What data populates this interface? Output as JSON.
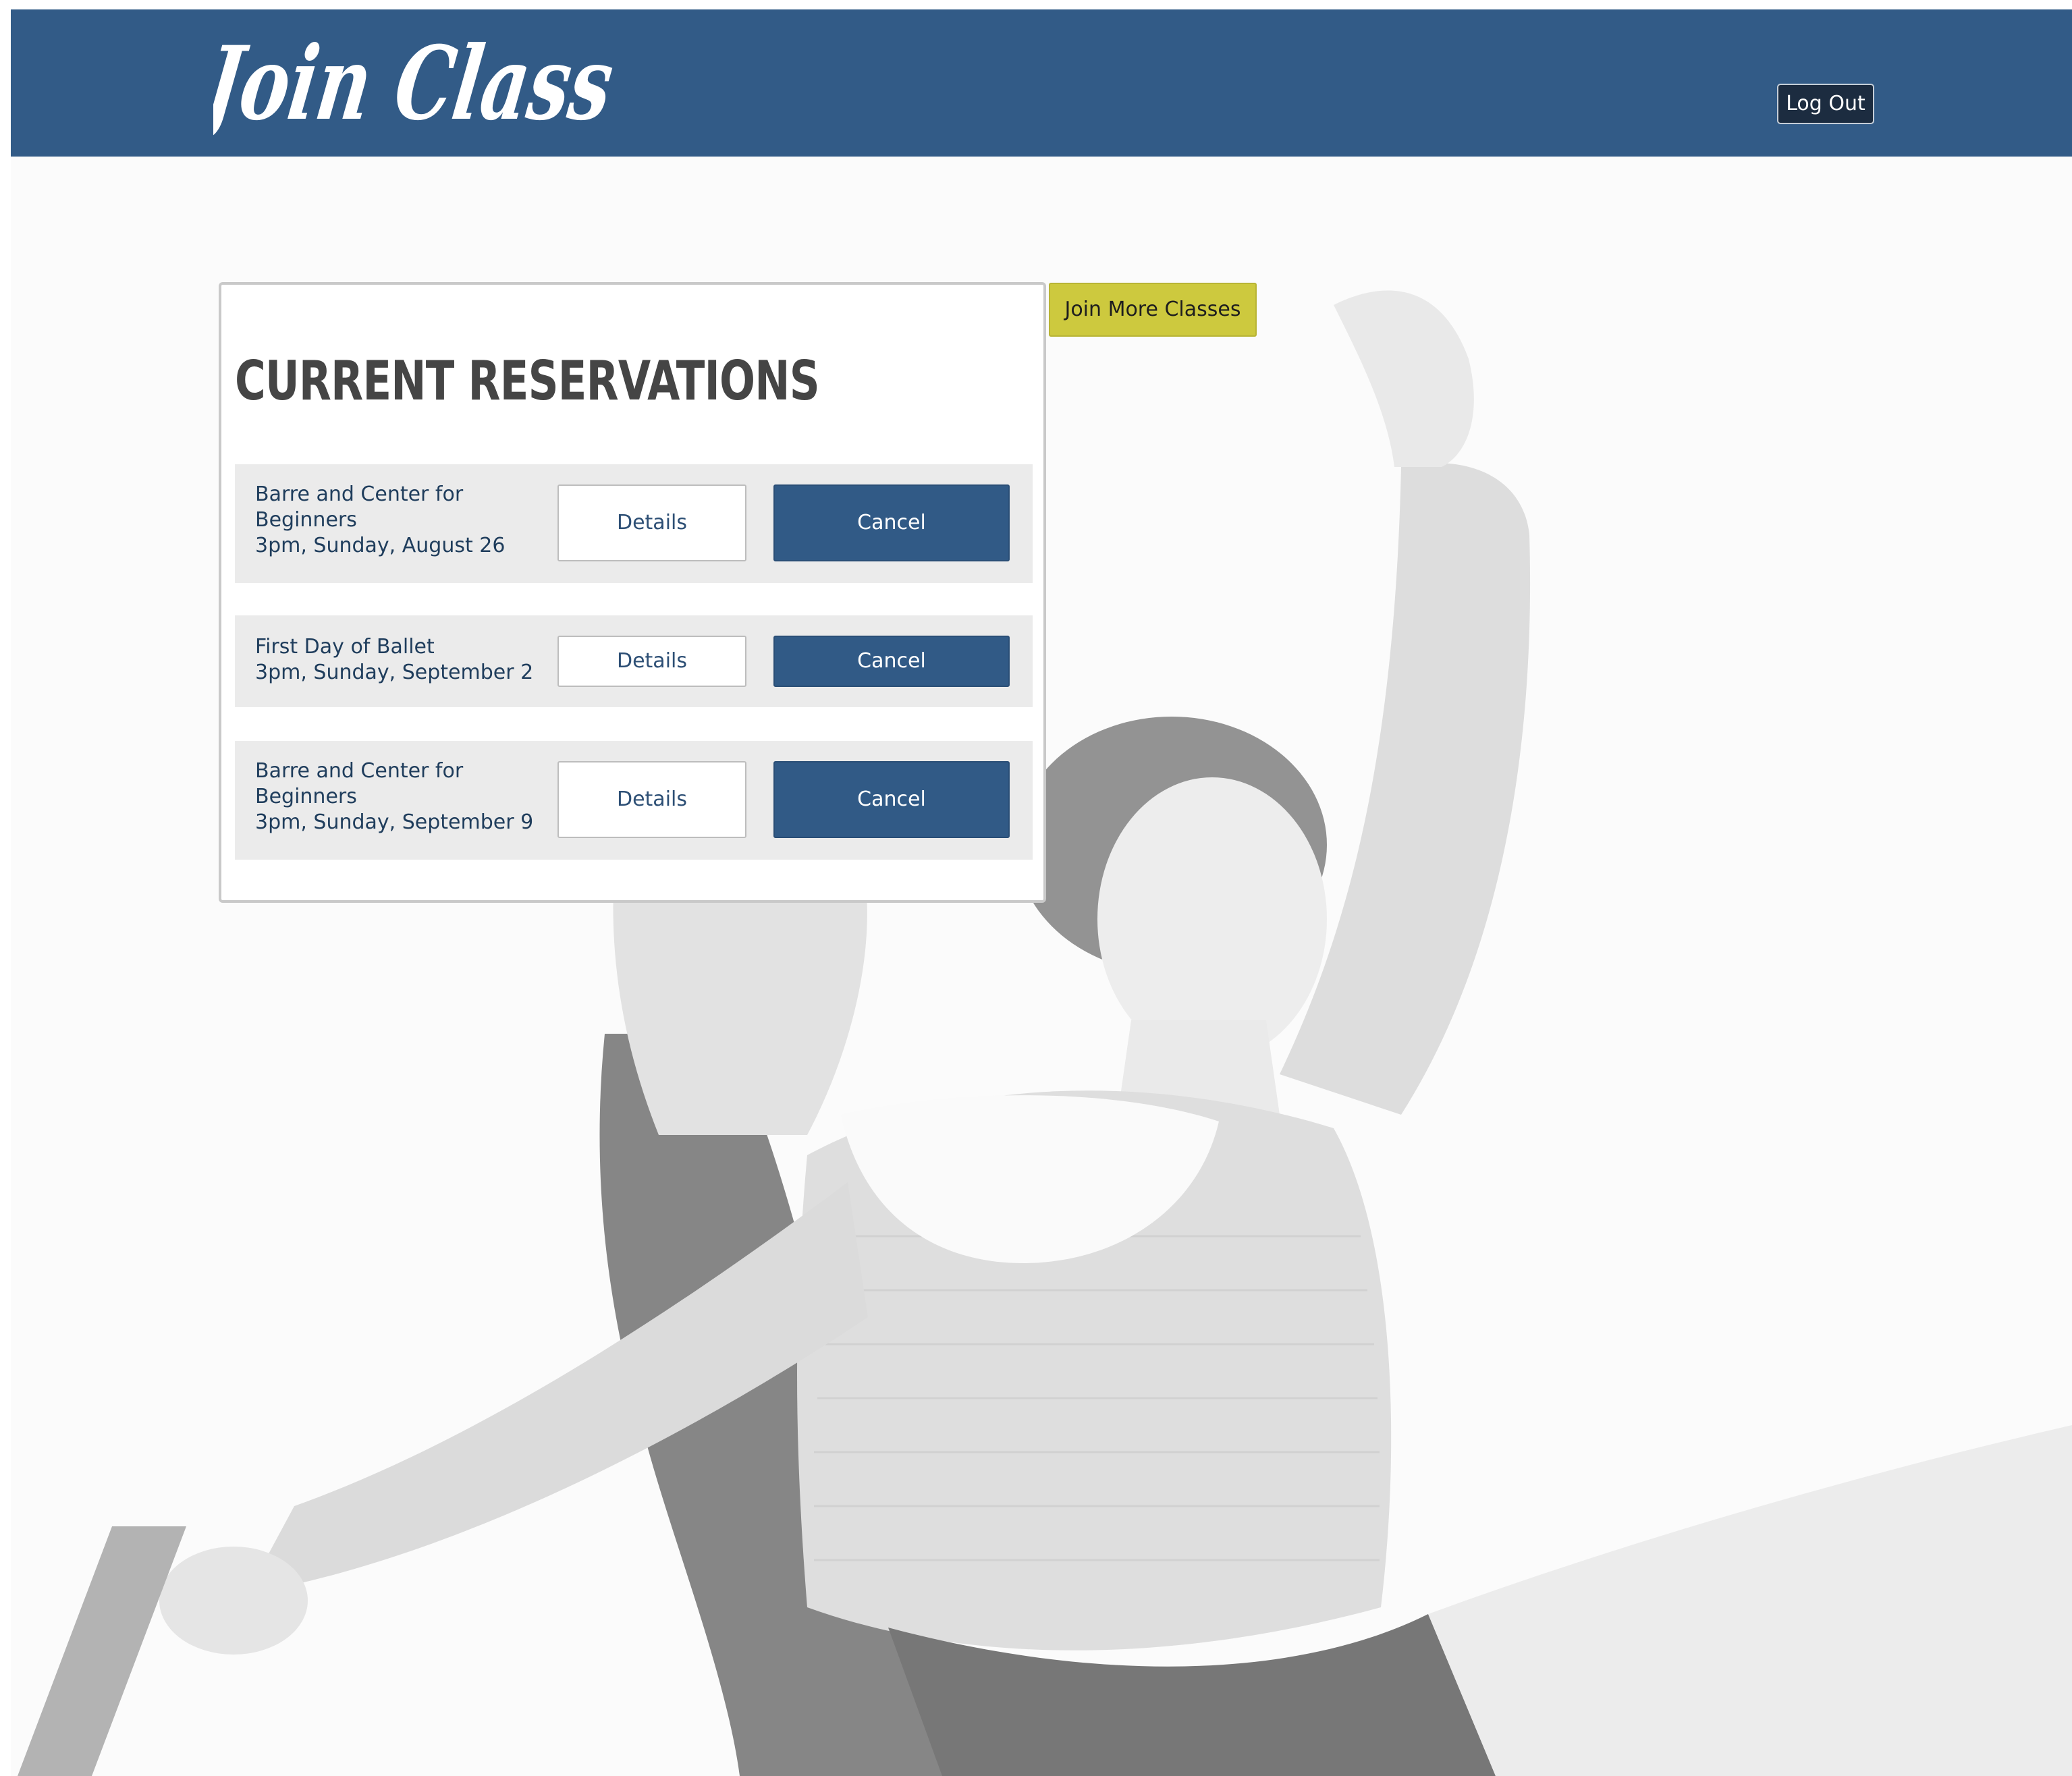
{
  "header": {
    "logo_text": "Join Class",
    "logout_label": "Log Out"
  },
  "actions": {
    "join_more_label": "Join More Classes"
  },
  "reservations": {
    "title": "CURRENT RESERVATIONS",
    "items": [
      {
        "class_name_line1": "Barre and Center for",
        "class_name_line2": "Beginners",
        "time": "3pm, Sunday, August 26",
        "details_label": "Details",
        "cancel_label": "Cancel"
      },
      {
        "class_name_line1": "First Day of Ballet",
        "class_name_line2": "",
        "time": "3pm, Sunday, September 2",
        "details_label": "Details",
        "cancel_label": "Cancel"
      },
      {
        "class_name_line1": "Barre and Center for",
        "class_name_line2": "Beginners",
        "time": "3pm, Sunday, September 9",
        "details_label": "Details",
        "cancel_label": "Cancel"
      }
    ]
  },
  "colors": {
    "header": "#325b87",
    "accent_button": "#cdc93e",
    "cancel_button": "#315a86",
    "row_background": "#ebebeb"
  }
}
